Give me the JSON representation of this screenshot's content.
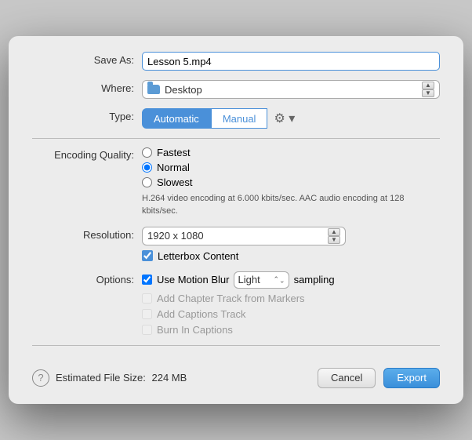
{
  "dialog": {
    "save_as_label": "Save As:",
    "save_as_value": "Lesson 5.mp4",
    "where_label": "Where:",
    "where_value": "Desktop",
    "type_label": "Type:",
    "type_automatic": "Automatic",
    "type_manual": "Manual",
    "encoding_label": "Encoding Quality:",
    "encoding_fastest": "Fastest",
    "encoding_normal": "Normal",
    "encoding_slowest": "Slowest",
    "encoding_desc": "H.264 video encoding at 6.000 kbits/sec.  AAC audio encoding at 128 kbits/sec.",
    "resolution_label": "Resolution:",
    "resolution_value": "1920 x 1080",
    "letterbox_label": "Letterbox Content",
    "options_label": "Options:",
    "use_motion_blur": "Use Motion Blur",
    "sampling_label": "sampling",
    "motion_value": "Light",
    "add_chapter": "Add Chapter Track from Markers",
    "add_captions": "Add Captions Track",
    "burn_captions": "Burn In Captions",
    "file_size_label": "Estimated File Size:",
    "file_size_value": "224 MB",
    "cancel_label": "Cancel",
    "export_label": "Export",
    "help_label": "?"
  }
}
